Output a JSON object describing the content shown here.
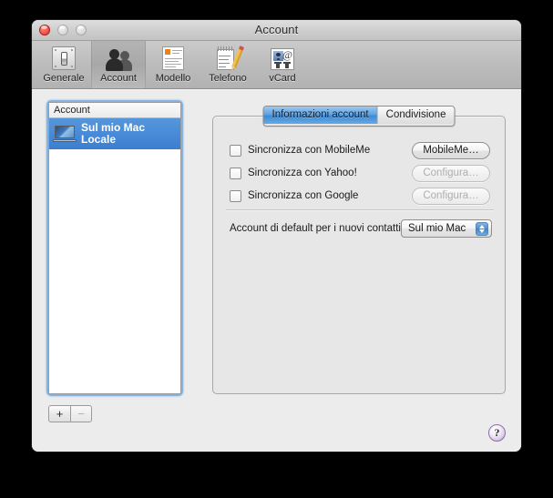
{
  "window": {
    "title": "Account",
    "traffic_lights": [
      {
        "name": "close",
        "color": "#f0544a",
        "enabled": true
      },
      {
        "name": "minimize",
        "color": "#d8d8d8",
        "enabled": false
      },
      {
        "name": "zoom",
        "color": "#d8d8d8",
        "enabled": false
      }
    ]
  },
  "toolbar": {
    "items": [
      {
        "label": "Generale",
        "icon": "switch-plate-icon",
        "selected": false
      },
      {
        "label": "Account",
        "icon": "two-people-icon",
        "selected": true
      },
      {
        "label": "Modello",
        "icon": "card-template-icon",
        "selected": false
      },
      {
        "label": "Telefono",
        "icon": "notepad-pencil-icon",
        "selected": false
      },
      {
        "label": "vCard",
        "icon": "vcard-icon",
        "selected": false
      }
    ]
  },
  "sidebar": {
    "header": "Account",
    "accounts": [
      {
        "name": "Sul mio Mac",
        "subtitle": "Locale",
        "icon": "laptop-icon",
        "selected": true
      }
    ],
    "add_label": "+",
    "remove_label": "−",
    "add_enabled": true,
    "remove_enabled": false
  },
  "tabs": [
    {
      "label": "Informazioni account",
      "active": true
    },
    {
      "label": "Condivisione",
      "active": false
    }
  ],
  "panel": {
    "sync_rows": [
      {
        "label": "Sincronizza con MobileMe",
        "checked": false,
        "button": "MobileMe…",
        "button_enabled": true
      },
      {
        "label": "Sincronizza con Yahoo!",
        "checked": false,
        "button": "Configura…",
        "button_enabled": false
      },
      {
        "label": "Sincronizza con Google",
        "checked": false,
        "button": "Configura…",
        "button_enabled": false
      }
    ],
    "default_account": {
      "label": "Account di default per i nuovi contatti:",
      "value": "Sul mio Mac",
      "options": [
        "Sul mio Mac"
      ]
    }
  },
  "help": {
    "label": "?",
    "accent": "#a98fc2"
  },
  "colors": {
    "selection_blue": "#3c7fd0",
    "window_bg": "#ececec",
    "panel_bg": "#e7e7e7",
    "focus_ring": "#74aade"
  }
}
